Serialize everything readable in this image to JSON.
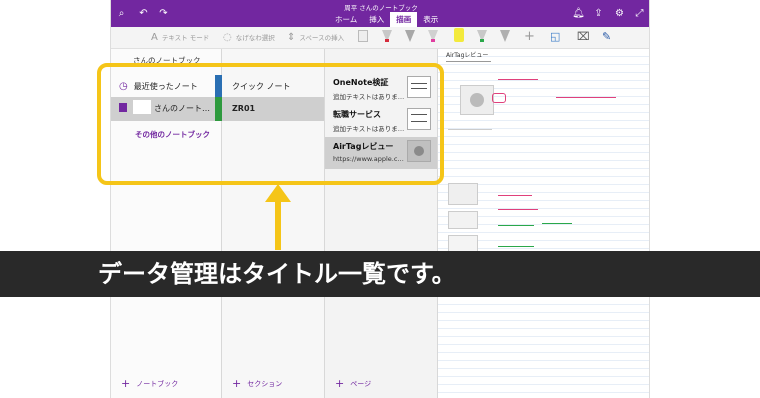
{
  "titlebar": {
    "doc_title": "周平 さんのノートブック",
    "tabs": [
      {
        "label": "ホーム",
        "active": false
      },
      {
        "label": "挿入",
        "active": false
      },
      {
        "label": "描画",
        "active": true
      },
      {
        "label": "表示",
        "active": false
      }
    ],
    "left_icons": [
      "search-icon",
      "undo-icon",
      "redo-icon"
    ],
    "right_icons": [
      "bell-icon",
      "share-icon",
      "gear-icon",
      "expand-icon"
    ]
  },
  "ribbon": {
    "text_mode": "テキスト モード",
    "lasso": "なげなわ選択",
    "space": "スペースの挿入"
  },
  "notebooks": {
    "header": "さんのノートブック",
    "recent": "最近使ったノート",
    "current": "さんのノート…",
    "other": "その他のノートブック",
    "add": "ノートブック"
  },
  "sections": {
    "items": [
      {
        "label": "クイック ノート",
        "selected": false
      },
      {
        "label": "ZR01",
        "selected": true
      }
    ],
    "add": "セクション"
  },
  "pages": {
    "items": [
      {
        "title": "OneNote検証",
        "subtitle": "追加テキストはありま…",
        "selected": false
      },
      {
        "title": "転職サービス",
        "subtitle": "追加テキストはありま…",
        "selected": false
      },
      {
        "title": "AirTagレビュー",
        "subtitle": "https://www.apple.c…",
        "selected": true
      }
    ],
    "add": "ページ"
  },
  "canvas": {
    "page_title": "AirTagレビュー"
  },
  "caption": "データ管理はタイトル一覧です。",
  "colors": {
    "brand": "#7227a0",
    "highlight": "#f5c518",
    "caption_bg": "#292929",
    "notebook_tab": "#2a6fb3",
    "section_tab": "#2e9a3e"
  }
}
